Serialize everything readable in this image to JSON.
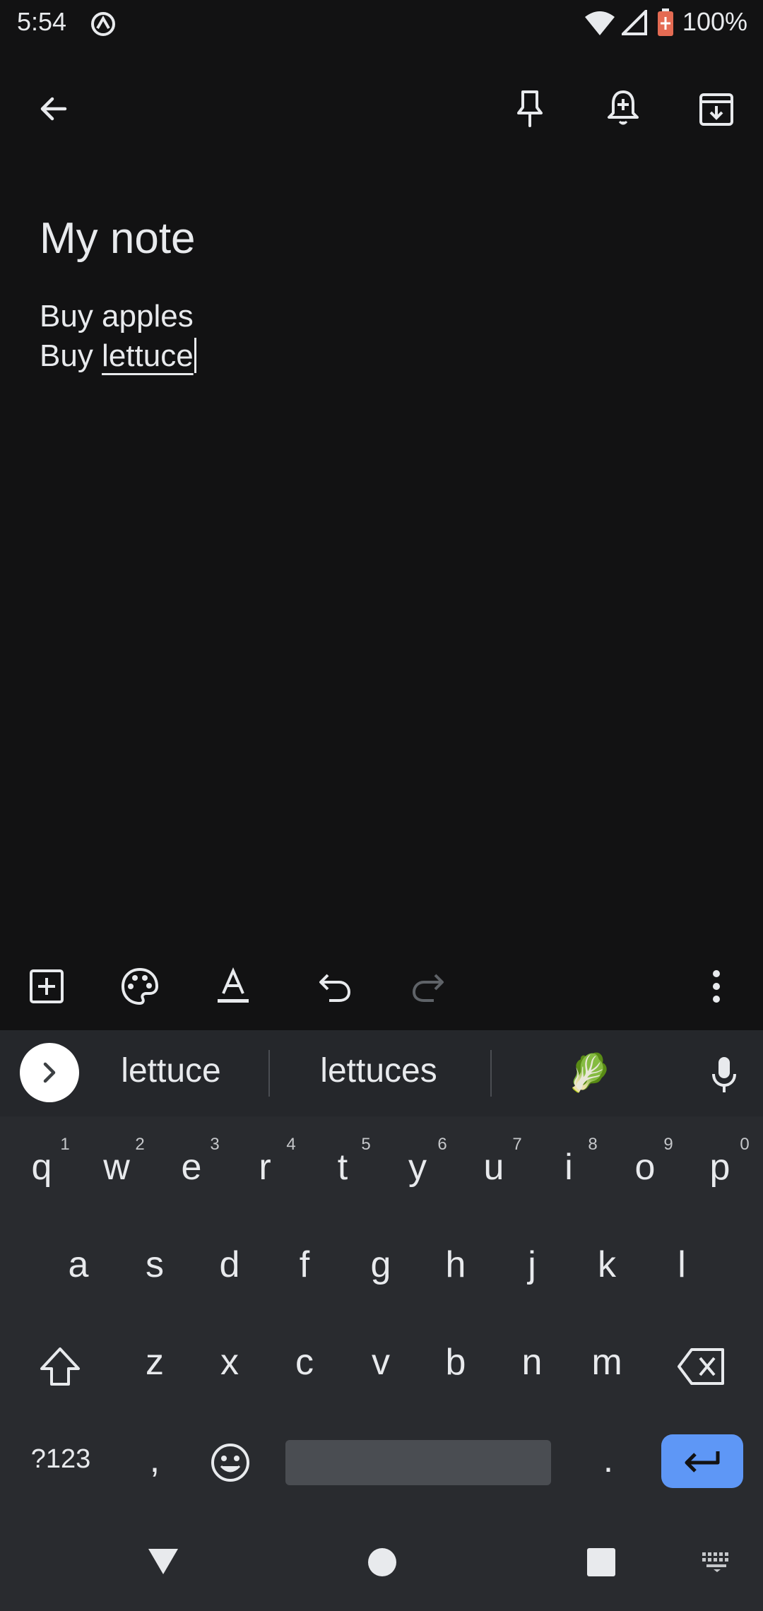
{
  "status_bar": {
    "time": "5:54",
    "battery": "100%",
    "icons": [
      "assistant-icon",
      "wifi-icon",
      "signal-icon",
      "battery-icon"
    ]
  },
  "top_bar": {
    "icons": [
      "back-arrow-icon",
      "pin-icon",
      "reminder-bell-icon",
      "archive-icon"
    ]
  },
  "note": {
    "title": "My note",
    "line1": "Buy apples",
    "line2_prefix": "Buy ",
    "line2_word": "lettuce"
  },
  "editor_toolbar": {
    "icons": [
      "add-box-icon",
      "palette-icon",
      "text-format-icon",
      "undo-icon",
      "redo-icon",
      "more-vert-icon"
    ]
  },
  "keyboard": {
    "suggestions": [
      "lettuce",
      "lettuces"
    ],
    "emoji_suggestion": "🥬",
    "row1": [
      "q",
      "w",
      "e",
      "r",
      "t",
      "y",
      "u",
      "i",
      "o",
      "p"
    ],
    "row1_hints": [
      "1",
      "2",
      "3",
      "4",
      "5",
      "6",
      "7",
      "8",
      "9",
      "0"
    ],
    "row2": [
      "a",
      "s",
      "d",
      "f",
      "g",
      "h",
      "j",
      "k",
      "l"
    ],
    "row3": [
      "z",
      "x",
      "c",
      "v",
      "b",
      "n",
      "m"
    ],
    "symbols_key": "?123",
    "comma": ",",
    "period": ".",
    "colors": {
      "background": "#292b2f",
      "enter": "#5e97f6"
    }
  },
  "colors": {
    "app_background": "#121213",
    "text": "#e8eaed"
  }
}
